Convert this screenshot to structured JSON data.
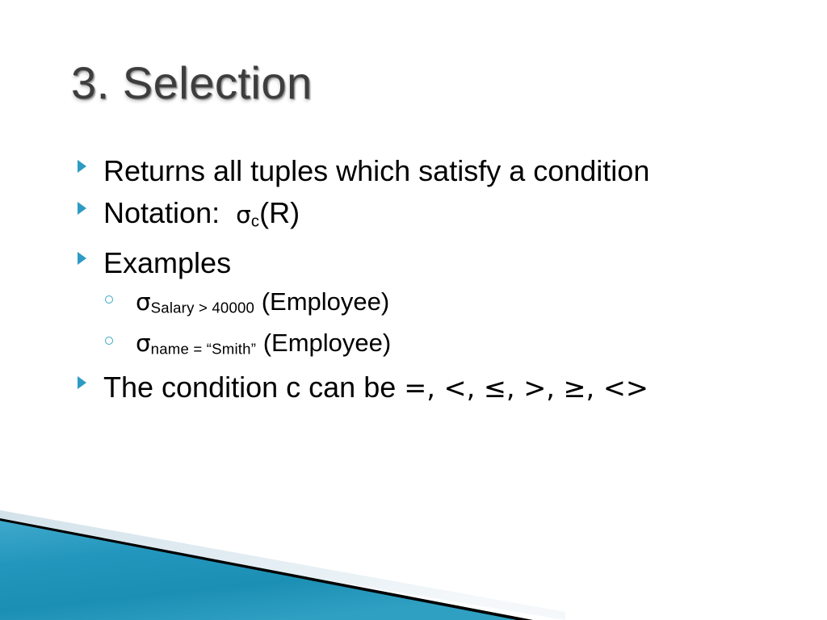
{
  "slide": {
    "title": "3. Selection",
    "background_color": "#ffffff",
    "title_color": "#3d3d3d",
    "accent_color": "#2e9bc4",
    "bullets": [
      {
        "level": 1,
        "marker": "triangle-bullet",
        "text": "Returns all tuples which satisfy a condition"
      },
      {
        "level": 1,
        "marker": "triangle-bullet",
        "text_prefix": "Notation:  ",
        "sigma": "σ",
        "subscript": "c",
        "text_suffix": "(R)"
      },
      {
        "level": 1,
        "marker": "triangle-bullet",
        "text": "Examples"
      },
      {
        "level": 2,
        "marker": "circle-bullet",
        "sigma": "σ",
        "subscript": "Salary > 40000",
        "text_suffix": " (Employee)"
      },
      {
        "level": 2,
        "marker": "circle-bullet",
        "sigma": "σ",
        "subscript": "name = “Smith”",
        "text_suffix": " (Employee)"
      },
      {
        "level": 1,
        "marker": "triangle-bullet",
        "text_prefix": "The condition c can be ",
        "operators": "=, <, ≤, >, ≥, <>"
      }
    ]
  },
  "decoration": {
    "name": "bottom-left-corner-graphic",
    "teal_color": "#1c8fb4",
    "teal_color_light": "#4fb4d2",
    "stripe_color": "#000000",
    "pale_band_color": "#dfe9ef"
  }
}
